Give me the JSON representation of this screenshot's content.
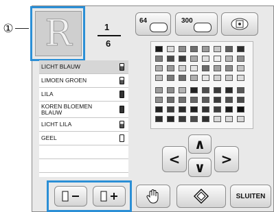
{
  "callout": {
    "number": "①"
  },
  "preview": {
    "letter": "R"
  },
  "counter": {
    "current": "1",
    "total": "6"
  },
  "threads": [
    {
      "name": "LICHT BLAUW",
      "bobbin": "partial",
      "selected": true
    },
    {
      "name": "LIMOEN GROEN",
      "bobbin": "partial",
      "selected": false
    },
    {
      "name": "LILA",
      "bobbin": "full",
      "selected": false
    },
    {
      "name": "KOREN BLOEMEN BLAUW",
      "bobbin": "full",
      "selected": false
    },
    {
      "name": "LICHT LILA",
      "bobbin": "partial",
      "selected": false
    },
    {
      "name": "GEEL",
      "bobbin": "empty",
      "selected": false
    }
  ],
  "palette_buttons": {
    "p64": "64",
    "p300": "300"
  },
  "bottom": {
    "close_label": "SLUITEN"
  },
  "colors": {
    "highlight": "#2b8fd6",
    "panel": "#e9e9e9"
  },
  "palette_swatches": [
    [
      "#1a1a1a",
      "#d9d9d9",
      "#8a8a8a",
      "#6e6e6e",
      "#9a9a9a",
      "#c8c8c8",
      "#5e5e5e",
      "#2e2e2e"
    ],
    [
      "#7c7c7c",
      "#4a4a4a",
      "#3c3c3c",
      "#a9a9a9",
      "#dedede",
      "#eeeeee",
      "#b8b8b8",
      "#8f8f8f"
    ],
    [
      "#b0b0b0",
      "#999999",
      "#cfcfcf",
      "#e4e4e4",
      "#6a6a6a",
      "#a0a0a0",
      "#8b8b8b",
      "#c2c2c2"
    ],
    [
      "#bdbdbd",
      "#7a7a7a",
      "#6b6b6b",
      "#afafaf",
      "#e6e6e6",
      "#d2d2d2",
      "#c9c9c9",
      "#dcdcdc"
    ],
    [
      "#9c9c9c",
      "#8c8c8c",
      "#b3b3b3",
      "#222222",
      "#4d4d4d",
      "#3a3a3a",
      "#2a2a2a",
      "#585858"
    ],
    [
      "#8f8f8f",
      "#6c6c6c",
      "#707070",
      "#666666",
      "#5a5a5a",
      "#3b3b3b",
      "#4f4f4f",
      "#4a4a4a"
    ],
    [
      "#222222",
      "#3c3c3c",
      "#2b2b2b",
      "#1f1f1f",
      "#333333",
      "#3e3e3e",
      "#1c1c1c",
      "#111111"
    ],
    [
      "#2d2d2d",
      "#262626",
      "#3a3a3a",
      "#4c4c4c",
      "#2f2f2f",
      "#d8d8d8",
      "#d8d8d8",
      "#d8d8d8"
    ]
  ]
}
